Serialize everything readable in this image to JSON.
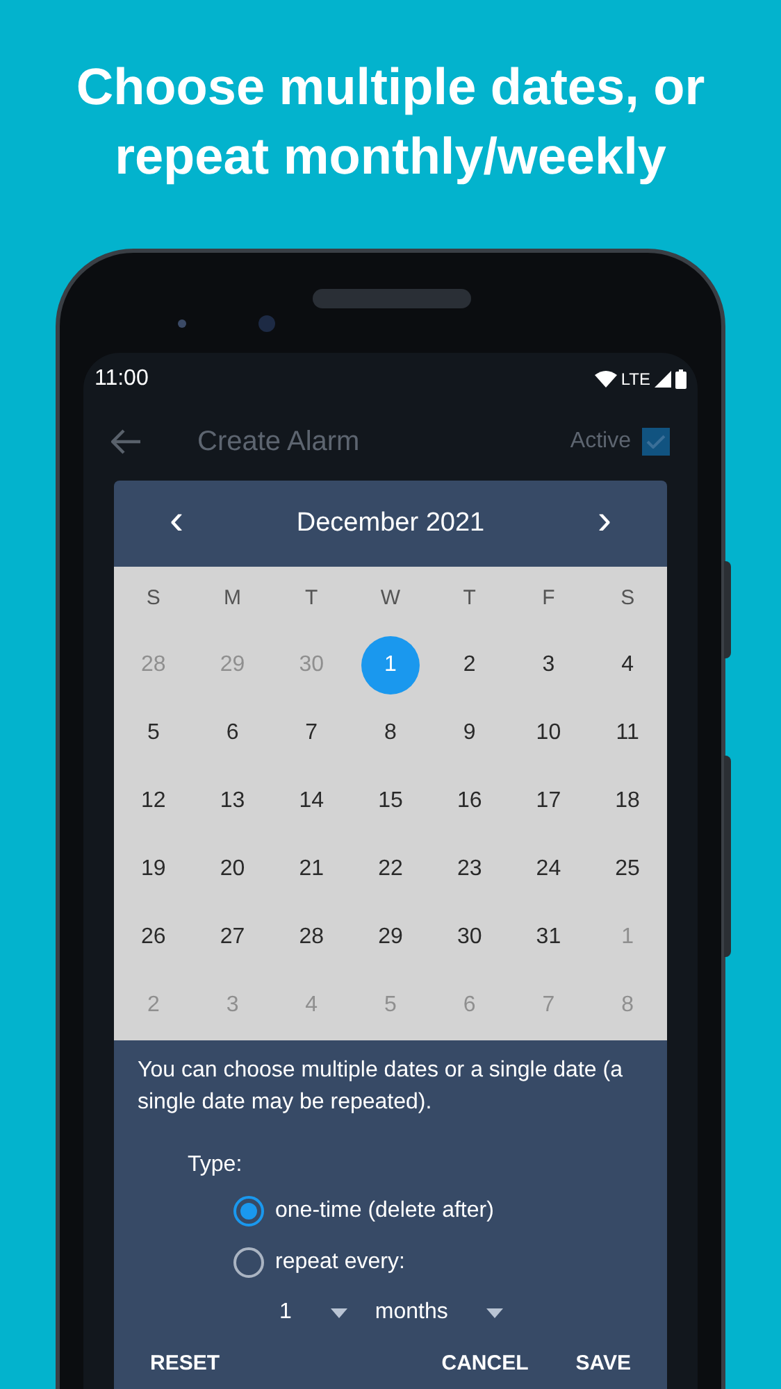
{
  "headline": [
    "Choose multiple dates, or",
    "repeat monthly/weekly"
  ],
  "status_bar": {
    "time": "11:00",
    "network": "LTE"
  },
  "app_bar": {
    "title": "Create Alarm",
    "active": {
      "label": "Active",
      "checked": true
    }
  },
  "dialog": {
    "month_label": "December  2021",
    "prev": "‹",
    "next": "›",
    "weekdays": [
      "S",
      "M",
      "T",
      "W",
      "T",
      "F",
      "S"
    ],
    "days": [
      {
        "label": "28",
        "in_month": false,
        "selected": false
      },
      {
        "label": "29",
        "in_month": false,
        "selected": false
      },
      {
        "label": "30",
        "in_month": false,
        "selected": false
      },
      {
        "label": "1",
        "in_month": true,
        "selected": true
      },
      {
        "label": "2",
        "in_month": true,
        "selected": false
      },
      {
        "label": "3",
        "in_month": true,
        "selected": false
      },
      {
        "label": "4",
        "in_month": true,
        "selected": false
      },
      {
        "label": "5",
        "in_month": true,
        "selected": false
      },
      {
        "label": "6",
        "in_month": true,
        "selected": false
      },
      {
        "label": "7",
        "in_month": true,
        "selected": false
      },
      {
        "label": "8",
        "in_month": true,
        "selected": false
      },
      {
        "label": "9",
        "in_month": true,
        "selected": false
      },
      {
        "label": "10",
        "in_month": true,
        "selected": false
      },
      {
        "label": "11",
        "in_month": true,
        "selected": false
      },
      {
        "label": "12",
        "in_month": true,
        "selected": false
      },
      {
        "label": "13",
        "in_month": true,
        "selected": false
      },
      {
        "label": "14",
        "in_month": true,
        "selected": false
      },
      {
        "label": "15",
        "in_month": true,
        "selected": false
      },
      {
        "label": "16",
        "in_month": true,
        "selected": false
      },
      {
        "label": "17",
        "in_month": true,
        "selected": false
      },
      {
        "label": "18",
        "in_month": true,
        "selected": false
      },
      {
        "label": "19",
        "in_month": true,
        "selected": false
      },
      {
        "label": "20",
        "in_month": true,
        "selected": false
      },
      {
        "label": "21",
        "in_month": true,
        "selected": false
      },
      {
        "label": "22",
        "in_month": true,
        "selected": false
      },
      {
        "label": "23",
        "in_month": true,
        "selected": false
      },
      {
        "label": "24",
        "in_month": true,
        "selected": false
      },
      {
        "label": "25",
        "in_month": true,
        "selected": false
      },
      {
        "label": "26",
        "in_month": true,
        "selected": false
      },
      {
        "label": "27",
        "in_month": true,
        "selected": false
      },
      {
        "label": "28",
        "in_month": true,
        "selected": false
      },
      {
        "label": "29",
        "in_month": true,
        "selected": false
      },
      {
        "label": "30",
        "in_month": true,
        "selected": false
      },
      {
        "label": "31",
        "in_month": true,
        "selected": false
      },
      {
        "label": "1",
        "in_month": false,
        "selected": false
      },
      {
        "label": "2",
        "in_month": false,
        "selected": false
      },
      {
        "label": "3",
        "in_month": false,
        "selected": false
      },
      {
        "label": "4",
        "in_month": false,
        "selected": false
      },
      {
        "label": "5",
        "in_month": false,
        "selected": false
      },
      {
        "label": "6",
        "in_month": false,
        "selected": false
      },
      {
        "label": "7",
        "in_month": false,
        "selected": false
      },
      {
        "label": "8",
        "in_month": false,
        "selected": false
      }
    ],
    "description": "You can choose multiple dates or a single date (a single date may be repeated).",
    "type_label": "Type:",
    "options": [
      {
        "label": "one-time (delete after)",
        "selected": true
      },
      {
        "label": "repeat every:",
        "selected": false
      }
    ],
    "repeat": {
      "count": "1",
      "unit": "months"
    },
    "buttons": [
      "RESET",
      "CANCEL",
      "SAVE"
    ]
  }
}
